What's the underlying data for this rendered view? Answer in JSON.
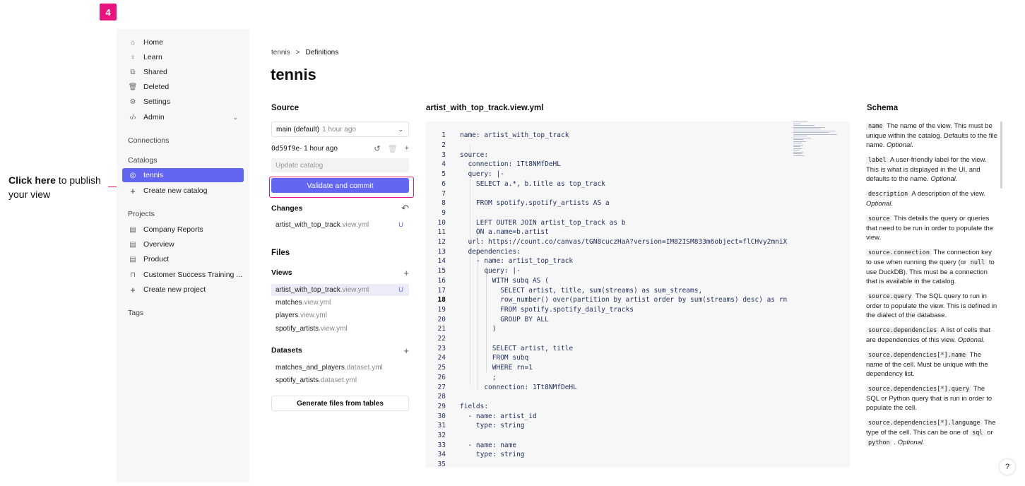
{
  "step_number": "4",
  "annotation": {
    "bold": "Click here",
    "rest": " to publish your view"
  },
  "sidebar": {
    "nav": [
      {
        "label": "Home",
        "icon": "home-icon"
      },
      {
        "label": "Learn",
        "icon": "lightbulb-icon"
      },
      {
        "label": "Shared",
        "icon": "shared-icon"
      },
      {
        "label": "Deleted",
        "icon": "trash-icon"
      },
      {
        "label": "Settings",
        "icon": "gear-icon"
      },
      {
        "label": "Admin",
        "icon": "code-icon"
      }
    ],
    "connections_label": "Connections",
    "catalogs_label": "Catalogs",
    "catalogs": [
      {
        "label": "tennis",
        "icon": "catalog-icon"
      },
      {
        "label": "Create new catalog",
        "icon": "plus-icon"
      }
    ],
    "projects_label": "Projects",
    "projects": [
      {
        "label": "Company Reports",
        "icon": "document-icon"
      },
      {
        "label": "Overview",
        "icon": "document-icon"
      },
      {
        "label": "Product",
        "icon": "document-icon"
      },
      {
        "label": "Customer Success Training ...",
        "icon": "lock-icon"
      },
      {
        "label": "Create new project",
        "icon": "plus-icon"
      }
    ],
    "tags_label": "Tags"
  },
  "breadcrumb": {
    "root": "tennis",
    "sep": ">",
    "current": "Definitions"
  },
  "page_title": "tennis",
  "source": {
    "heading": "Source",
    "branch": "main (default)",
    "branch_time": "1 hour ago",
    "commit_hash": "0d59f9e",
    "commit_time": " · 1 hour ago",
    "update_placeholder": "Update catalog",
    "validate_label": "Validate and commit"
  },
  "changes": {
    "heading": "Changes",
    "items": [
      {
        "name": "artist_with_top_track",
        "ext": ".view.yml",
        "status": "U"
      }
    ]
  },
  "files": {
    "heading": "Files",
    "views_label": "Views",
    "views": [
      {
        "name": "artist_with_top_track",
        "ext": ".view.yml",
        "status": "U"
      },
      {
        "name": "matches",
        "ext": ".view.yml",
        "status": ""
      },
      {
        "name": "players",
        "ext": ".view.yml",
        "status": ""
      },
      {
        "name": "spotify_artists",
        "ext": ".view.yml",
        "status": ""
      }
    ],
    "datasets_label": "Datasets",
    "datasets": [
      {
        "name": "matches_and_players",
        "ext": ".dataset.yml"
      },
      {
        "name": "spotify_artists",
        "ext": ".dataset.yml"
      }
    ],
    "generate_label": "Generate files from tables"
  },
  "editor": {
    "filename": "artist_with_top_track.view.yml",
    "lines": [
      "name: artist_with_top_track",
      "",
      "source:",
      "  connection: 1Tt8NMfDeHL",
      "  query: |-",
      "    SELECT a.*, b.title as top_track",
      "",
      "    FROM spotify.spotify_artists AS a",
      "",
      "    LEFT OUTER JOIN artist_top_track as b",
      "    ON a.name=b.artist",
      "  url: https://count.co/canvas/tGN8cuczHaA?version=IM82ISM833m6object=flCHvy2mniX",
      "  dependencies:",
      "    - name: artist_top_track",
      "      query: |-",
      "        WITH subq AS (",
      "          SELECT artist, title, sum(streams) as sum_streams,",
      "          row_number() over(partition by artist order by sum(streams) desc) as rn",
      "          FROM spotify.spotify_daily_tracks",
      "          GROUP BY ALL",
      "        )",
      "",
      "        SELECT artist, title",
      "        FROM subq",
      "        WHERE rn=1",
      "        ;",
      "      connection: 1Tt8NMfDeHL",
      "",
      "fields:",
      "  - name: artist_id",
      "    type: string",
      "",
      "  - name: name",
      "    type: string",
      ""
    ],
    "line_numbers": [
      "1",
      "2",
      "3",
      "4",
      "5",
      "6",
      "7",
      "8",
      "9",
      "10",
      "11",
      "12",
      "13",
      "14",
      "15",
      "16",
      "17",
      "18",
      "19",
      "20",
      "21",
      "22",
      "23",
      "24",
      "25",
      "26",
      "27",
      "28",
      "29",
      "30",
      "31",
      "32",
      "33",
      "34",
      "35"
    ],
    "active_line": "18"
  },
  "schema": {
    "heading": "Schema",
    "entries": [
      {
        "key": "name",
        "text": " The name of the view. This must be unique within the catalog. Defaults to the file name. ",
        "opt": "Optional."
      },
      {
        "key": "label",
        "text": " A user-friendly label for the view. This is what is displayed in the UI, and defaults to the name. ",
        "opt": "Optional."
      },
      {
        "key": "description",
        "text": " A description of the view. ",
        "opt": "Optional."
      },
      {
        "key": "source",
        "text": " This details the query or queries that need to be run in order to populate the view.",
        "opt": ""
      },
      {
        "key": "source.connection",
        "text": " The connection key to use when running the query (or ",
        "code2": "null",
        "text2": " to use DuckDB). This must be a connection that is available in the catalog.",
        "opt": ""
      },
      {
        "key": "source.query",
        "text": " The SQL query to run in order to populate the view. This is defined in the dialect of the database.",
        "opt": ""
      },
      {
        "key": "source.dependencies",
        "text": " A list of cells that are dependencies of this view. ",
        "opt": "Optional."
      },
      {
        "key": "source.dependencies[*].name",
        "text": " The name of the cell. Must be unique with the dependency list.",
        "opt": ""
      },
      {
        "key": "source.dependencies[*].query",
        "text": " The SQL or Python query that is run in order to populate the cell.",
        "opt": ""
      },
      {
        "key": "source.dependencies[*].language",
        "text": " The type of the cell. This can be one of ",
        "code2": "sql",
        "text2": " or ",
        "code3": "python",
        "text3": " . ",
        "opt": "Optional."
      }
    ]
  },
  "help_label": "?",
  "colors": {
    "accent": "#6366f1",
    "annotation": "#e8157f"
  }
}
